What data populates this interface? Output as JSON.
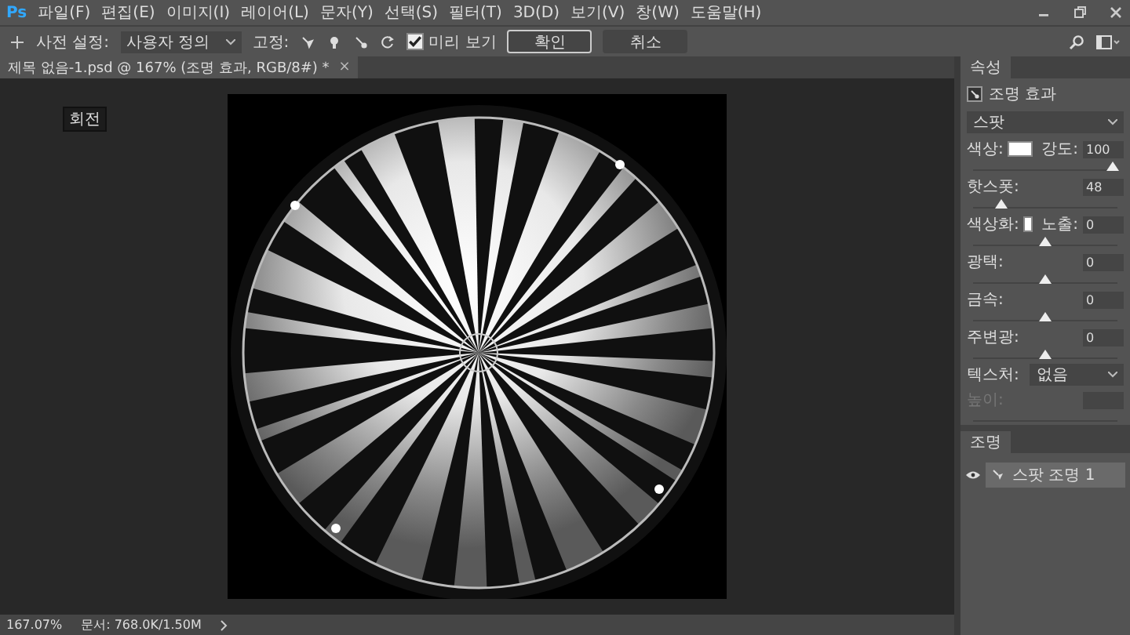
{
  "app": {
    "logo": "Ps"
  },
  "menu": [
    "파일(F)",
    "편집(E)",
    "이미지(I)",
    "레이어(L)",
    "문자(Y)",
    "선택(S)",
    "필터(T)",
    "3D(D)",
    "보기(V)",
    "창(W)",
    "도움말(H)"
  ],
  "options_bar": {
    "preset_label": "사전 설정:",
    "preset_value": "사용자 정의",
    "mode_label": "고정:",
    "preview": {
      "label": "미리 보기",
      "checked": true
    },
    "buttons": [
      {
        "label": "확인",
        "selected": true
      },
      {
        "label": "취소",
        "selected": false
      }
    ]
  },
  "document_tab": {
    "title": "제목 없음-1.psd @ 167% (조명 효과, RGB/8#) *",
    "close": "×"
  },
  "tooltip": "회전",
  "status_bar": {
    "zoom": "167.07%",
    "doc": "문서: 768.0K/1.50M"
  },
  "properties": {
    "tab": "속성",
    "title": "조명 효과",
    "light_type": "스팟",
    "rows": [
      {
        "kind": "swatch",
        "label": "색상:",
        "label_2": "강도:",
        "value": "100",
        "level": 0.97,
        "disabled": false
      },
      {
        "kind": "plain",
        "label": "핫스폿:",
        "value": "48",
        "level": 0.2,
        "disabled": false
      },
      {
        "kind": "swatch",
        "label": "색상화:",
        "label_2": "노출:",
        "value": "0",
        "level": 0.5,
        "disabled": false
      },
      {
        "kind": "plain",
        "label": "광택:",
        "value": "0",
        "level": 0.5,
        "disabled": false
      },
      {
        "kind": "plain",
        "label": "금속:",
        "value": "0",
        "level": 0.5,
        "disabled": false
      },
      {
        "kind": "plain",
        "label": "주변광:",
        "value": "0",
        "level": 0.5,
        "disabled": false
      },
      {
        "kind": "dropdown",
        "label": "텍스처:",
        "value": "없음",
        "disabled": false
      },
      {
        "kind": "plain",
        "label": "높이:",
        "disabled": true
      }
    ]
  },
  "lights": {
    "tab": "조명",
    "items": [
      {
        "label": "스팟 조명 1",
        "selected": true
      }
    ]
  }
}
